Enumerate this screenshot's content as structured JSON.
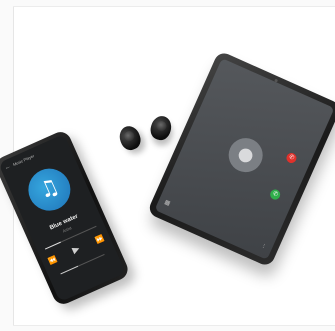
{
  "phone": {
    "header_title": "Music Player",
    "song_title": "Blue water",
    "song_artist": "Artist",
    "progress_fraction": 0.3,
    "volume_fraction": 0.4
  },
  "tablet": {
    "call_state": "incoming-call"
  },
  "icons": {
    "back": "back-arrow-icon",
    "note": "music-note-icon",
    "caller": "person-icon",
    "accept": "phone-accept-icon",
    "decline": "phone-decline-icon"
  },
  "colors": {
    "album_accent": "#2f8fd0",
    "accept": "#2fae4a",
    "decline": "#e0312b",
    "device_body": "#1a1a1a"
  }
}
